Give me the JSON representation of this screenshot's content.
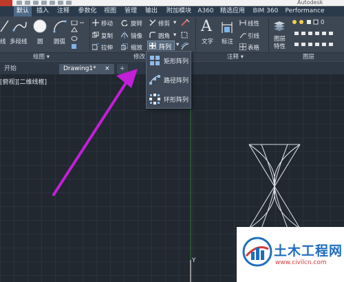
{
  "window": {
    "title_fragment": "Autodesk AutoCAD"
  },
  "ribbon_tabs": [
    {
      "label": "默认",
      "active": true
    },
    {
      "label": "插入"
    },
    {
      "label": "注释"
    },
    {
      "label": "参数化"
    },
    {
      "label": "视图"
    },
    {
      "label": "管理"
    },
    {
      "label": "输出"
    },
    {
      "label": "附加模块"
    },
    {
      "label": "A360"
    },
    {
      "label": "精选应用"
    },
    {
      "label": "BIM 360"
    },
    {
      "label": "Performance"
    }
  ],
  "draw_panel": {
    "polyline": "线",
    "multiline": "多段线",
    "circle": "圆",
    "arc": "圆弧",
    "name": "绘图 ▾"
  },
  "modify_panel": {
    "move": "移动",
    "rotate": "旋转",
    "trim": "修剪",
    "copy": "复制",
    "mirror": "镜像",
    "fillet": "圆角",
    "stretch": "拉伸",
    "scale": "缩放",
    "array": "阵列",
    "name": "修改"
  },
  "annotation_panel": {
    "text": "文字",
    "dimension": "标注",
    "linear": "线性",
    "leader": "引线",
    "table": "表格",
    "name": "注释 ▾"
  },
  "layers_panel": {
    "layer_props": "图层\n特性",
    "layer_value": "0",
    "name": "图层"
  },
  "array_menu": [
    {
      "label": "矩形阵列",
      "icon": "rectangular-array-icon"
    },
    {
      "label": "路径阵列",
      "icon": "path-array-icon"
    },
    {
      "label": "环形阵列",
      "icon": "polar-array-icon"
    }
  ],
  "doc_tabs": [
    {
      "label": "开始"
    },
    {
      "label": "Drawing1*",
      "active": true,
      "close": "×"
    },
    {
      "label": "+"
    }
  ],
  "viewport": {
    "label": "[俯视][二维线框]",
    "ucs_y": "Y"
  },
  "watermark": {
    "title": "土木工程网",
    "url": "www.civilcn.com"
  },
  "colors": {
    "annotation_arrow": "#c21fd6",
    "ribbon_bg": "#3d4754",
    "viewport_bg": "#212830",
    "watermark_blue": "#1f6dbf",
    "watermark_red": "#d33a3a"
  }
}
